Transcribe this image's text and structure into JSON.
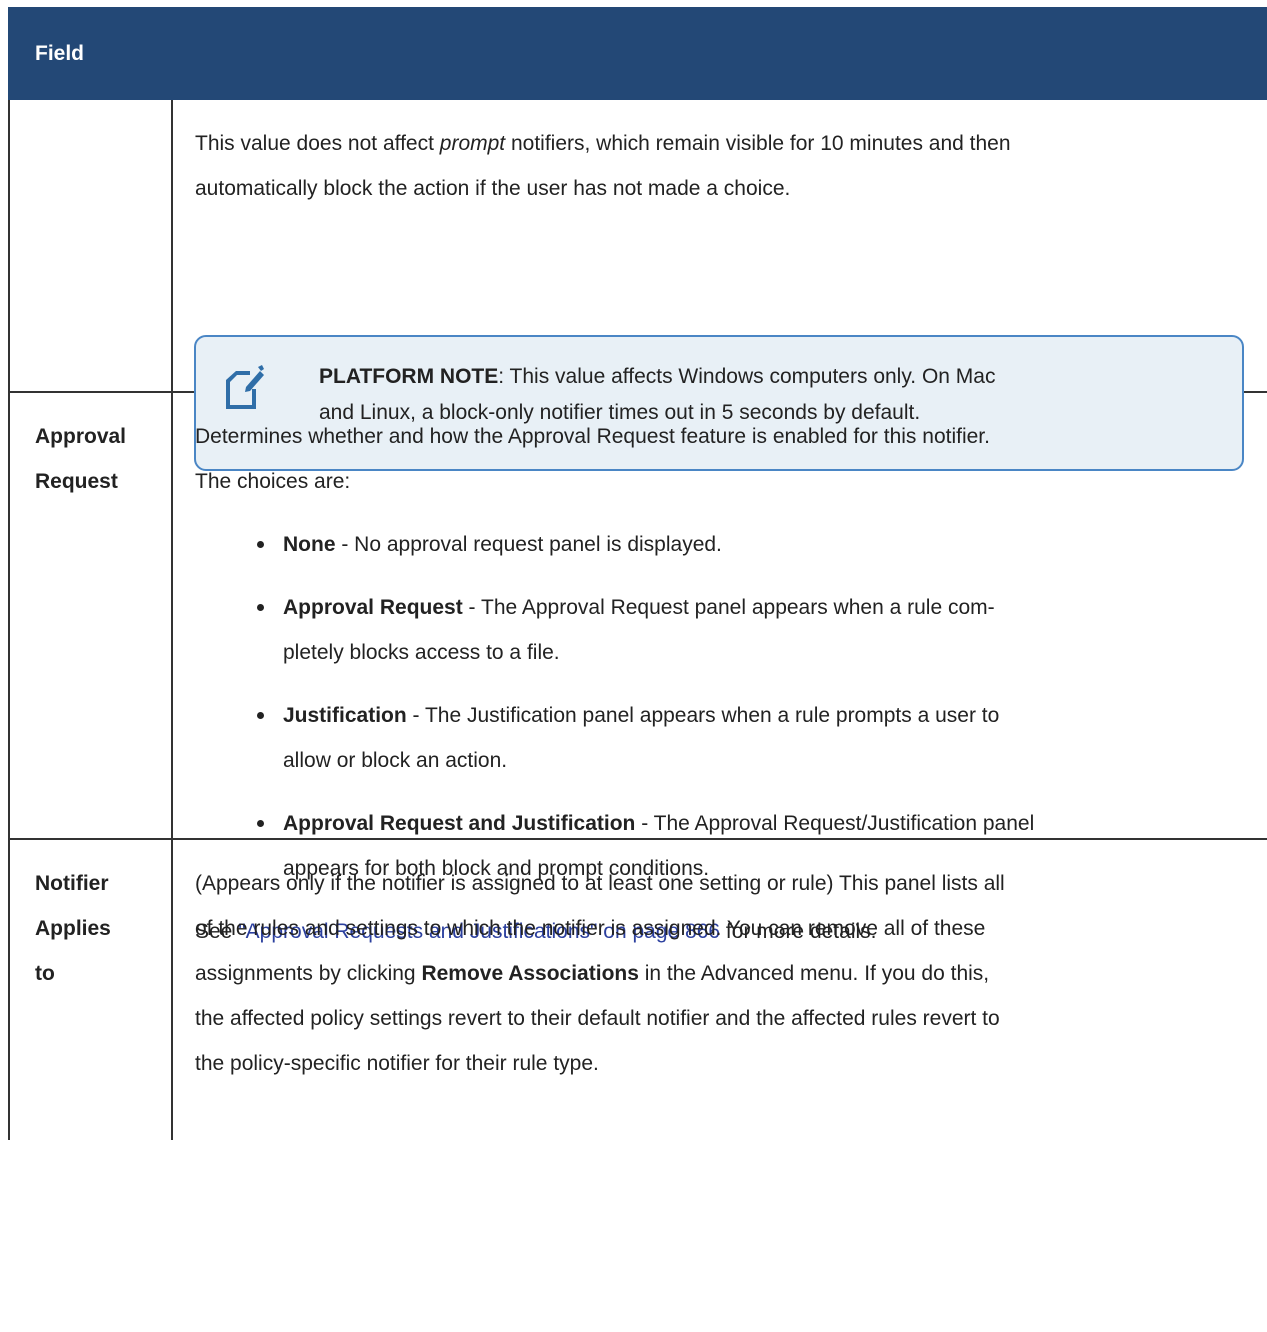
{
  "header": {
    "field_label": "Field"
  },
  "row1": {
    "para1_before": "This value does not affect ",
    "para1_italic": "prompt",
    "para1_after": " notifiers, which remain visible for 10 minutes and then",
    "para1_line2": "automatically block the action if the user has not made a choice.",
    "note_icon": "note-pencil-icon",
    "note_label": "PLATFORM NOTE",
    "note_text1": ": This value affects Windows computers only. On Mac",
    "note_text2": "and Linux, a block-only notifier times out in 5 seconds by default."
  },
  "row2": {
    "label_line1": "Approval",
    "label_line2": "Request",
    "intro1": "Determines whether and how the Approval Request feature is enabled for this notifier.",
    "intro2": "The choices are:",
    "choices": [
      {
        "term": "None",
        "line1": " - No approval request panel is displayed.",
        "line2": ""
      },
      {
        "term": "Approval Request",
        "line1": " - The Approval Request panel appears when a rule com-",
        "line2": "pletely blocks access to a file."
      },
      {
        "term": "Justification",
        "line1": " - The Justification panel appears when a rule prompts a user to",
        "line2": "allow or block an action."
      },
      {
        "term": "Approval Request and Justification",
        "line1": " - The Approval Request/Justification panel",
        "line2": "appears for both block and prompt conditions."
      }
    ],
    "see_before": "See ",
    "see_link": "\"Approval Requests and Justifications\" on page 866",
    "see_after": " for more details."
  },
  "row3": {
    "label_line1": "Notifier",
    "label_line2": "Applies",
    "label_line3": "to",
    "line1": "(Appears only if the notifier is assigned to at least one setting or rule) This panel lists all",
    "line2": "of the rules and settings to which the notifier is assigned. You can remove all of these",
    "line3_before": "assignments by clicking ",
    "line3_bold": "Remove Associations",
    "line3_after": " in the Advanced menu. If you do this,",
    "line4": "the affected policy settings revert to their default notifier and the affected rules revert to",
    "line5": "the policy-specific notifier for their rule type."
  },
  "colors": {
    "header_bg": "#234876",
    "note_bg": "#e8f0f6",
    "note_border": "#4a86c5",
    "link": "#2b3f9e"
  }
}
